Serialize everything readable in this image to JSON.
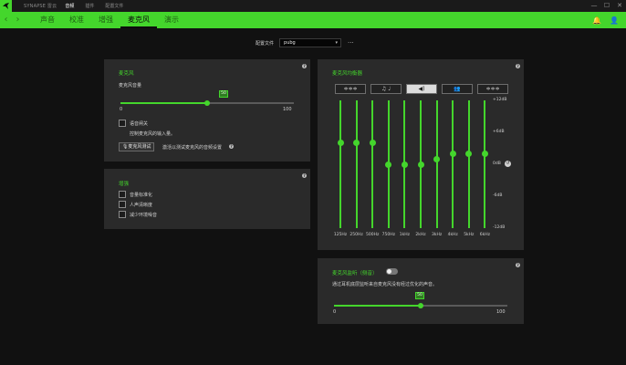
{
  "titlebar": {
    "brand": "SYNAPSE 雷云",
    "nav": [
      {
        "label": "音频",
        "active": true
      },
      {
        "label": "插件",
        "active": false
      },
      {
        "label": "配置文件",
        "active": false
      }
    ],
    "window_controls": [
      "—",
      "☐",
      "✕"
    ]
  },
  "subnav": {
    "back": "‹",
    "forward": "›",
    "tabs": [
      {
        "label": "声音",
        "active": false
      },
      {
        "label": "校准",
        "active": false
      },
      {
        "label": "增强",
        "active": false
      },
      {
        "label": "麦克风",
        "active": true
      },
      {
        "label": "演示",
        "active": false
      }
    ]
  },
  "profile": {
    "label": "配置文件",
    "value": "pubg",
    "caret": "▾",
    "more": "···"
  },
  "mic_panel": {
    "title": "麦克风",
    "volume_label": "麦克风音量",
    "volume_value": 50,
    "volume_tip": "50",
    "min": "0",
    "max": "100",
    "voice_gate_label": "语音闸关",
    "voice_gate_desc": "控制麦克风的输入量。",
    "test_button": "麦克风测试",
    "test_desc": "激活以测试麦克风的音频设置",
    "help": "?"
  },
  "enhance_panel": {
    "title": "增强",
    "options": [
      "音量标准化",
      "人声清晰度",
      "减少环境噪音"
    ],
    "help": "?"
  },
  "eq_panel": {
    "title": "麦克风均衡器",
    "help": "?",
    "reset": "↺",
    "presets": [
      {
        "icon": "≑≑≑",
        "active": false
      },
      {
        "icon": "♫ ♩",
        "active": false
      },
      {
        "icon": "◀)",
        "active": true
      },
      {
        "icon": "👥",
        "active": false
      },
      {
        "icon": "≑≑≑",
        "active": false
      }
    ],
    "db_labels": [
      "+12dB",
      "+6dB",
      "0dB",
      "-6dB",
      "-12dB"
    ],
    "bands": [
      {
        "label": "125Hz",
        "gain_db": 4
      },
      {
        "label": "250Hz",
        "gain_db": 4
      },
      {
        "label": "500Hz",
        "gain_db": 4
      },
      {
        "label": "750Hz",
        "gain_db": 0
      },
      {
        "label": "1kHz",
        "gain_db": 0
      },
      {
        "label": "2kHz",
        "gain_db": 0
      },
      {
        "label": "3kHz",
        "gain_db": 1
      },
      {
        "label": "4kHz",
        "gain_db": 2
      },
      {
        "label": "5kHz",
        "gain_db": 2
      },
      {
        "label": "6kHz",
        "gain_db": 2
      }
    ]
  },
  "monitor_panel": {
    "title": "麦克风监听（侧音）",
    "desc": "通过耳机底层监听来自麦克风没有经过优化的声音。",
    "toggle_on": false,
    "value": 50,
    "tip": "50",
    "min": "0",
    "max": "100",
    "help": "?"
  },
  "colors": {
    "accent": "#44d62c",
    "panel": "#2a2a2a",
    "background": "#111111"
  }
}
